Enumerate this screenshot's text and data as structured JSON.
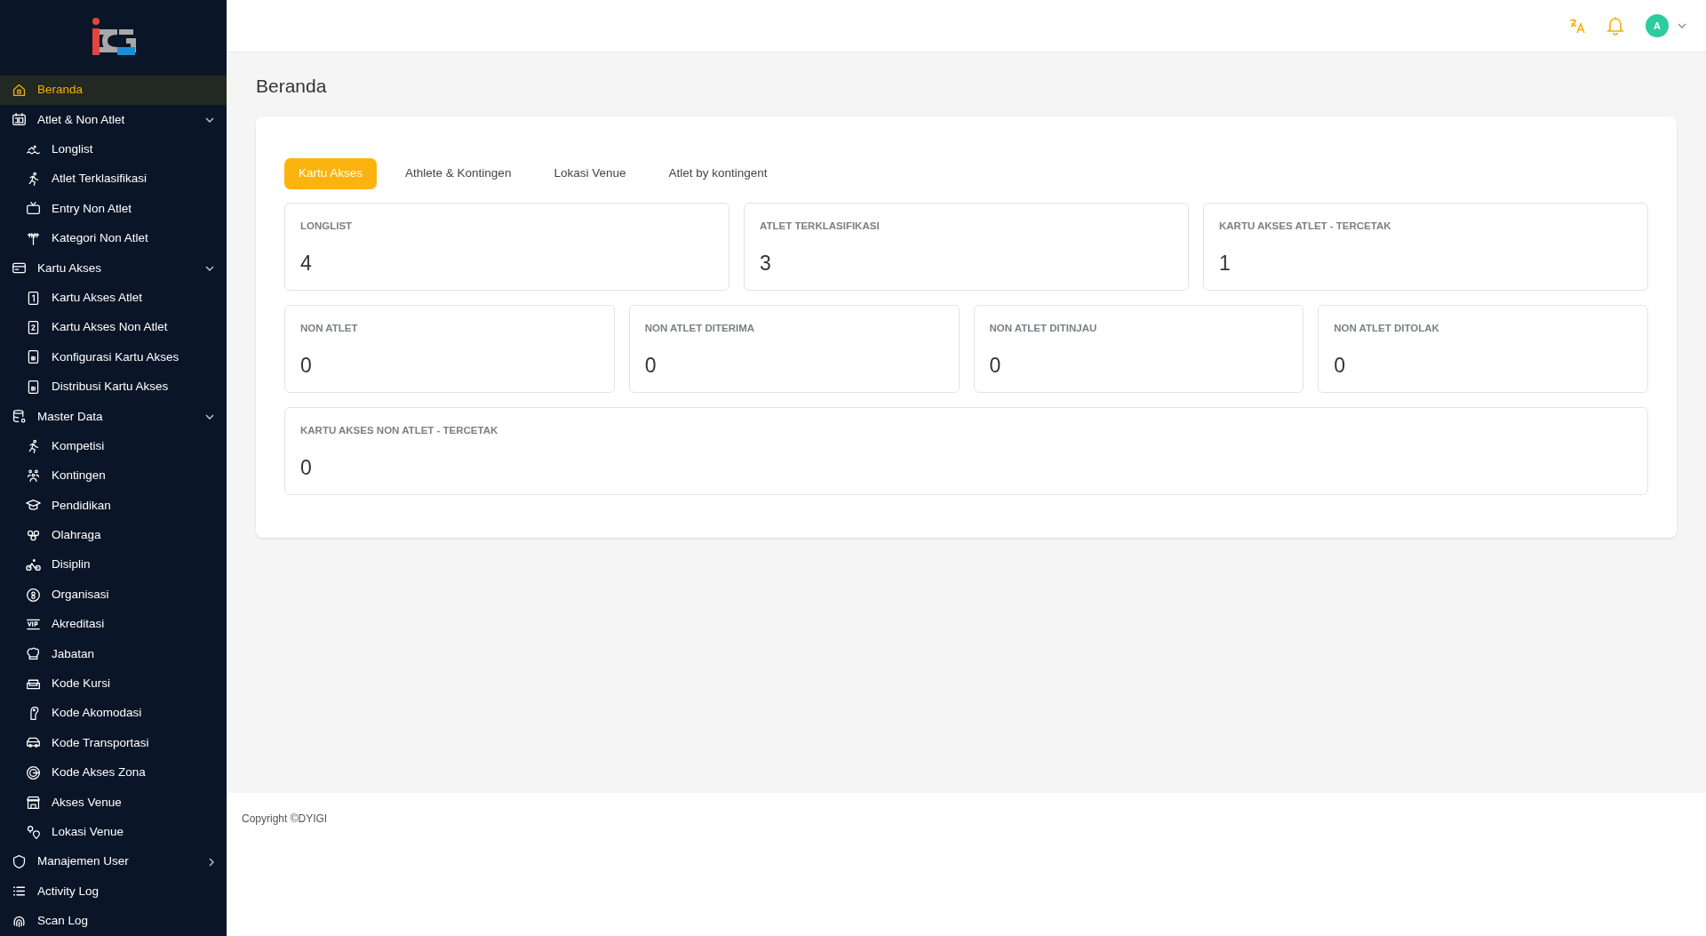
{
  "sidebar": {
    "items": [
      {
        "label": "Beranda",
        "kind": "link",
        "selected": true
      },
      {
        "label": "Atlet & Non Atlet",
        "kind": "group",
        "expanded": true,
        "selected": false,
        "children": [
          {
            "label": "Longlist",
            "selected": false
          },
          {
            "label": "Atlet Terklasifikasi",
            "selected": false
          },
          {
            "label": "Entry Non Atlet",
            "selected": false
          },
          {
            "label": "Kategori Non Atlet",
            "selected": false
          }
        ]
      },
      {
        "label": "Kartu Akses",
        "kind": "group",
        "expanded": true,
        "selected": false,
        "children": [
          {
            "label": "Kartu Akses Atlet",
            "selected": false
          },
          {
            "label": "Kartu Akses Non Atlet",
            "selected": false
          },
          {
            "label": "Konfigurasi Kartu Akses",
            "selected": false
          },
          {
            "label": "Distribusi Kartu Akses",
            "selected": false
          }
        ]
      },
      {
        "label": "Master Data",
        "kind": "group",
        "expanded": true,
        "selected": false,
        "children": [
          {
            "label": "Kompetisi",
            "selected": false
          },
          {
            "label": "Kontingen",
            "selected": false
          },
          {
            "label": "Pendidikan",
            "selected": false
          },
          {
            "label": "Olahraga",
            "selected": false
          },
          {
            "label": "Disiplin",
            "selected": false
          },
          {
            "label": "Organisasi",
            "selected": false
          },
          {
            "label": "Akreditasi",
            "selected": false
          },
          {
            "label": "Jabatan",
            "selected": false
          },
          {
            "label": "Kode Kursi",
            "selected": false
          },
          {
            "label": "Kode Akomodasi",
            "selected": false
          },
          {
            "label": "Kode Transportasi",
            "selected": false
          },
          {
            "label": "Kode Akses Zona",
            "selected": false
          },
          {
            "label": "Akses Venue",
            "selected": false
          },
          {
            "label": "Lokasi Venue",
            "selected": false
          }
        ]
      },
      {
        "label": "Manajemen User",
        "kind": "group",
        "expanded": false,
        "selected": false
      },
      {
        "label": "Activity Log",
        "kind": "link",
        "selected": false
      },
      {
        "label": "Scan Log",
        "kind": "link",
        "selected": false
      }
    ]
  },
  "header": {
    "avatar": "A"
  },
  "page_title": "Beranda",
  "tabs": [
    {
      "label": "Kartu Akses",
      "selected": true
    },
    {
      "label": "Athlete & Kontingen",
      "selected": false
    },
    {
      "label": "Lokasi Venue",
      "selected": false
    },
    {
      "label": "Atlet by kontingent",
      "selected": false
    }
  ],
  "stat_rows": [
    [
      {
        "label": "LONGLIST",
        "value": "4"
      },
      {
        "label": "ATLET TERKLASIFIKASI",
        "value": "3"
      },
      {
        "label": "KARTU AKSES ATLET - TERCETAK",
        "value": "1"
      }
    ],
    [
      {
        "label": "NON ATLET",
        "value": "0"
      },
      {
        "label": "NON ATLET DITERIMA",
        "value": "0"
      },
      {
        "label": "NON ATLET DITINJAU",
        "value": "0"
      },
      {
        "label": "NON ATLET DITOLAK",
        "value": "0"
      }
    ],
    [
      {
        "label": "KARTU AKSES NON ATLET - TERCETAK",
        "value": "0"
      }
    ]
  ],
  "footer": "Copyright ©DYIGI"
}
